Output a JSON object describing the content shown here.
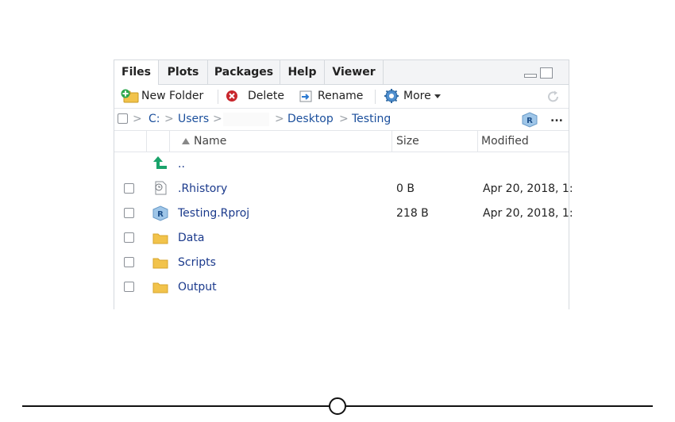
{
  "tabs": [
    {
      "label": "Files",
      "active": true
    },
    {
      "label": "Plots",
      "active": false
    },
    {
      "label": "Packages",
      "active": false
    },
    {
      "label": "Help",
      "active": false
    },
    {
      "label": "Viewer",
      "active": false
    }
  ],
  "toolbar": {
    "new_folder": "New Folder",
    "delete": "Delete",
    "rename": "Rename",
    "more": "More"
  },
  "path": {
    "drive": "C:",
    "users": "Users",
    "desktop": "Desktop",
    "testing": "Testing",
    "more": "..."
  },
  "columns": {
    "name": "Name",
    "size": "Size",
    "modified": "Modified"
  },
  "parent_dir": "..",
  "files": [
    {
      "name": ".Rhistory",
      "size": "0 B",
      "modified": "Apr 20, 2018, 1:",
      "icon": "rhistory-icon"
    },
    {
      "name": "Testing.Rproj",
      "size": "218 B",
      "modified": "Apr 20, 2018, 1:",
      "icon": "rproj-icon"
    },
    {
      "name": "Data",
      "size": "",
      "modified": "",
      "icon": "folder-icon"
    },
    {
      "name": "Scripts",
      "size": "",
      "modified": "",
      "icon": "folder-icon"
    },
    {
      "name": "Output",
      "size": "",
      "modified": "",
      "icon": "folder-icon"
    }
  ],
  "colors": {
    "link": "#1b3a8c",
    "folder": "#f2c34b",
    "up_arrow": "#1aa36b"
  }
}
